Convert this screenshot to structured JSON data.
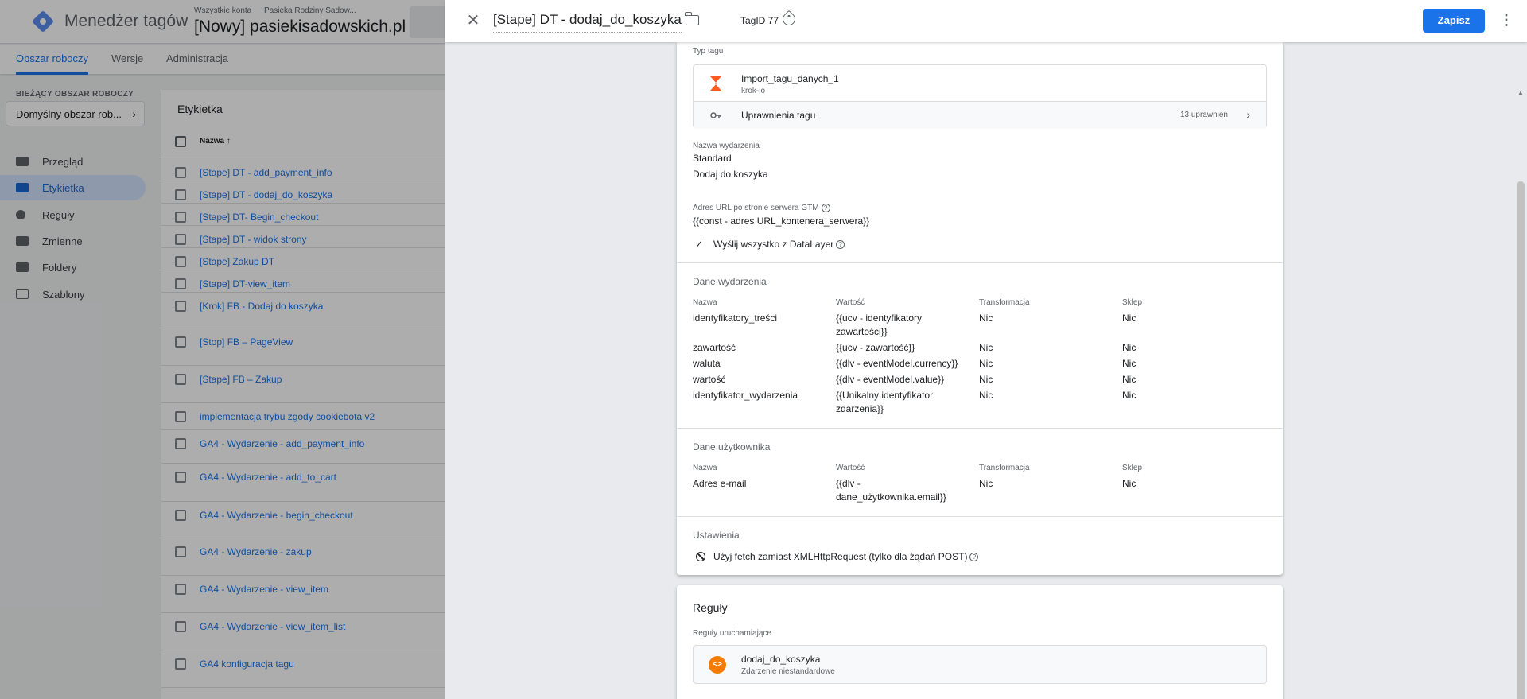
{
  "app": {
    "product_name": "Menedżer tagów",
    "breadcrumb_accounts": "Wszystkie konta",
    "breadcrumb_account": "Pasieka Rodziny Sadow...",
    "container_name": "[Nowy] pasiekisadowskich.pl",
    "tabs": [
      "Obszar roboczy",
      "Wersje",
      "Administracja"
    ],
    "workspace_label": "BIEŻĄCY OBSZAR ROBOCZY",
    "workspace_name": "Domyślny obszar rob...",
    "nav": [
      "Przegląd",
      "Etykietka",
      "Reguły",
      "Zmienne",
      "Foldery",
      "Szablony"
    ],
    "list_title": "Etykietka",
    "list_col_name": "Nazwa ↑",
    "tags": [
      "[Stape] DT - add_payment_info",
      "[Stape] DT - dodaj_do_koszyka",
      "[Stape] DT- Begin_checkout",
      "[Stape] DT - widok strony",
      "[Stape] Zakup DT",
      "[Stape] DT-view_item",
      "[Krok] FB - Dodaj do koszyka",
      "[Stop] FB – PageView",
      "[Stape] FB – Zakup",
      "implementacja trybu zgody cookiebota v2",
      "GA4 - Wydarzenie - add_payment_info",
      "GA4 - Wydarzenie - add_to_cart",
      "GA4 - Wydarzenie - begin_checkout",
      "GA4 - Wydarzenie - zakup",
      "GA4 - Wydarzenie - view_item",
      "GA4 - Wydarzenie - view_item_list",
      "GA4 konfiguracja tagu"
    ]
  },
  "sheet": {
    "title": "[Stape] DT - dodaj_do_koszyka",
    "tag_id": "TagID 77",
    "save_label": "Zapisz",
    "config": {
      "type_label": "Typ tagu",
      "type_name": "Import_tagu_danych_1",
      "type_vendor": "krok-io",
      "permissions_label": "Uprawnienia tagu",
      "permissions_count": "13 uprawnień",
      "event_name_label": "Nazwa wydarzenia",
      "event_name_type": "Standard",
      "event_name_value": "Dodaj do koszyka",
      "server_url_label": "Adres URL po stronie serwera GTM",
      "server_url_value": "{{const - adres URL_kontenera_serwera}}",
      "send_all_label": "Wyślij wszystko z DataLayer",
      "event_data_title": "Dane wydarzenia",
      "user_data_title": "Dane użytkownika",
      "col_headers": [
        "Nazwa",
        "Wartość",
        "Transformacja",
        "Sklep"
      ],
      "event_data_rows": [
        {
          "name": "identyfikatory_treści",
          "value": [
            "{{ucv - identyfikatory",
            "zawartości}}"
          ],
          "transform": "Nic",
          "store": "Nic"
        },
        {
          "name": "zawartość",
          "value": [
            "{{ucv - zawartość}}"
          ],
          "transform": "Nic",
          "store": "Nic"
        },
        {
          "name": "waluta",
          "value": [
            "{{dlv - eventModel.currency}}"
          ],
          "transform": "Nic",
          "store": "Nic"
        },
        {
          "name": "wartość",
          "value": [
            "{{dlv - eventModel.value}}"
          ],
          "transform": "Nic",
          "store": "Nic"
        },
        {
          "name": "identyfikator_wydarzenia",
          "value": [
            "{{Unikalny identyfikator",
            "zdarzenia}}"
          ],
          "transform": "Nic",
          "store": "Nic"
        }
      ],
      "user_data_rows": [
        {
          "name": "Adres e-mail",
          "value": [
            "{{dlv -",
            "dane_użytkownika.email}}"
          ],
          "transform": "Nic",
          "store": "Nic"
        }
      ],
      "settings_title": "Ustawienia",
      "settings_fetch_label": "Użyj fetch zamiast XMLHttpRequest (tylko dla żądań POST)"
    },
    "triggers": {
      "title": "Reguły",
      "subtitle": "Reguły uruchamiające",
      "trigger_name": "dodaj_do_koszyka",
      "trigger_type": "Zdarzenie niestandardowe"
    }
  },
  "colors": {
    "accent": "#1a73e8",
    "trigger_orange": "#f57c00",
    "tag_logo": "#ff5a1f"
  }
}
